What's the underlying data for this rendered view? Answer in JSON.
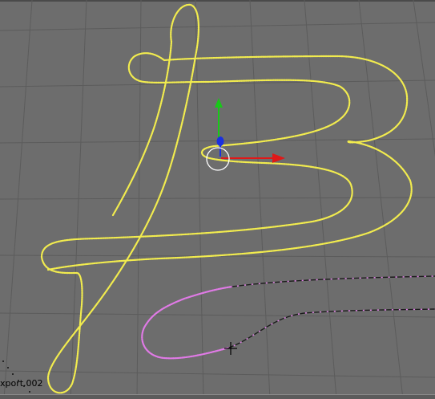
{
  "viewport": {
    "label": "xport.002",
    "background": "#6d6d6d",
    "grid_color": "#5a5a5a",
    "stroke_colors": {
      "yellow_curve": "#f2ec4e",
      "pink_curve": "#e07ae6",
      "dark_curve": "#1c1c1c"
    },
    "gizmo": {
      "x_axis_color": "#e01818",
      "y_axis_color": "#18c818",
      "z_axis_color": "#1a30e0",
      "ring_color": "#ffffff"
    },
    "cursor_icon": "crosshair-icon"
  }
}
